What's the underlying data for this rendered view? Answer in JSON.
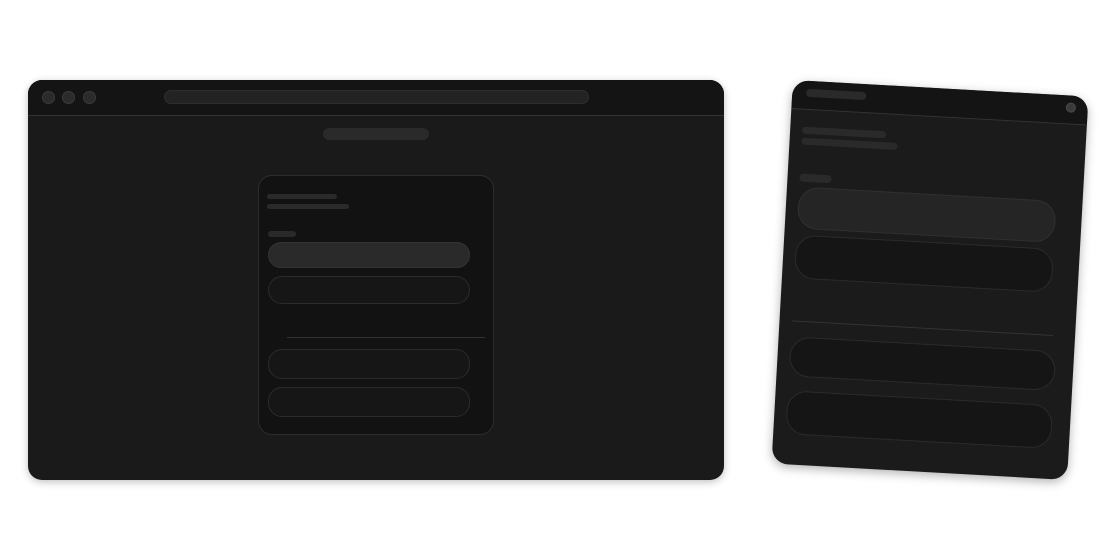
{
  "colors": {
    "page_background": "#ffffff",
    "window_background": "#1a1a1a",
    "chrome_background": "#141414",
    "card_background": "#121212",
    "active_item": "#2a2a2a",
    "border": "#2d2d2d"
  },
  "browser": {
    "window_controls": [
      "close-dot",
      "minimize-dot",
      "maximize-dot"
    ],
    "address_bar": {
      "value": ""
    },
    "page_title": "",
    "card": {
      "heading_lines": [
        "",
        ""
      ],
      "section_label": "",
      "items": [
        {
          "label": "",
          "state": "selected"
        },
        {
          "label": "",
          "state": "default"
        },
        {
          "label": "",
          "state": "default"
        },
        {
          "label": "",
          "state": "default"
        }
      ]
    }
  },
  "tablet": {
    "top_bar_title": "",
    "camera_icon": "camera-icon",
    "heading_lines": [
      "",
      ""
    ],
    "section_label": "",
    "items": [
      {
        "label": "",
        "state": "selected"
      },
      {
        "label": "",
        "state": "default"
      },
      {
        "label": "",
        "state": "default"
      },
      {
        "label": "",
        "state": "default"
      }
    ]
  }
}
